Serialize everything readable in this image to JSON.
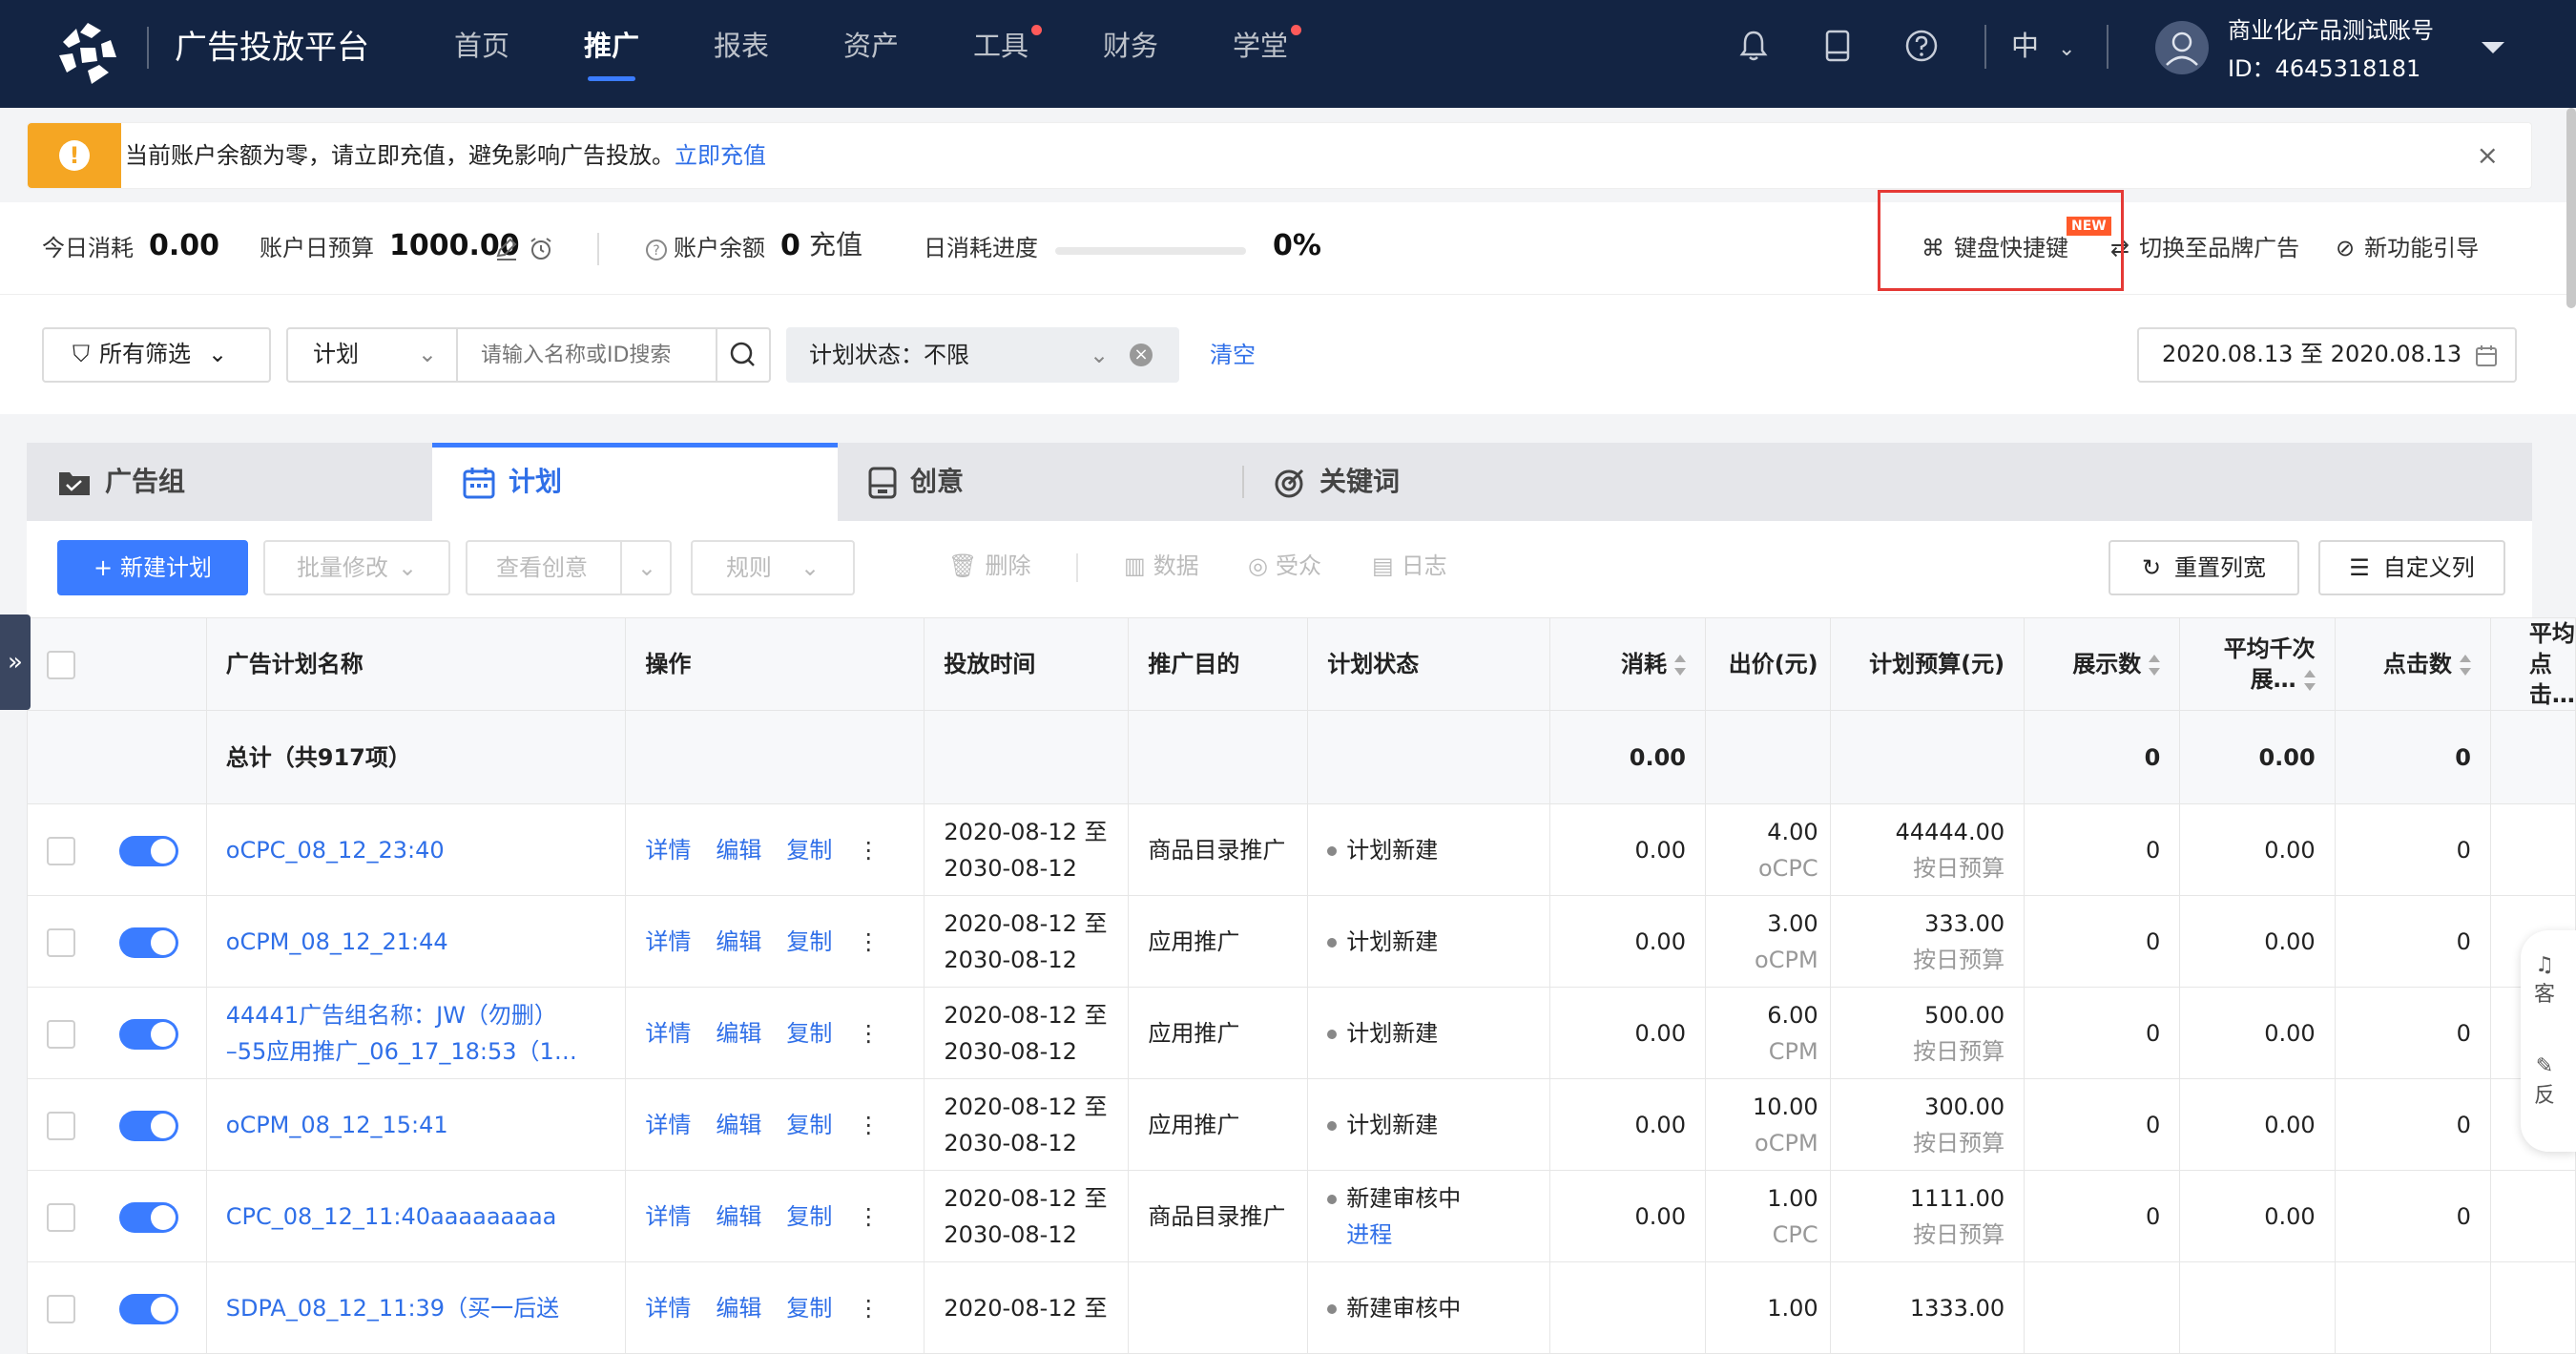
{
  "nav": {
    "brand": "广告投放平台",
    "items": [
      {
        "label": "首页",
        "active": false,
        "dot": false
      },
      {
        "label": "推广",
        "active": true,
        "dot": false
      },
      {
        "label": "报表",
        "active": false,
        "dot": false
      },
      {
        "label": "资产",
        "active": false,
        "dot": false
      },
      {
        "label": "工具",
        "active": false,
        "dot": true
      },
      {
        "label": "财务",
        "active": false,
        "dot": false
      },
      {
        "label": "学堂",
        "active": false,
        "dot": true
      }
    ],
    "language": "中",
    "account_name": "商业化产品测试账号",
    "account_id": "ID：4645318181"
  },
  "notice": {
    "message": "当前账户余额为零，请立即充值，避免影响广告投放。",
    "link": "立即充值"
  },
  "stats": {
    "today_spend_label": "今日消耗",
    "today_spend_value": "0.00",
    "daily_budget_label": "账户日预算",
    "daily_budget_value": "1000.00",
    "balance_label": "账户余额",
    "balance_value": "0",
    "recharge_label": "充值",
    "progress_label": "日消耗进度",
    "progress_value": "0%",
    "progress_fraction": 0,
    "shortcut_label": "键盘快捷键",
    "new_tag": "NEW",
    "switch_label": "切换至品牌广告",
    "guide_label": "新功能引导"
  },
  "filter": {
    "all_filters": "所有筛选",
    "scope": "计划",
    "search_placeholder": "请输入名称或ID搜索",
    "status_label": "计划状态：不限",
    "clear_label": "清空",
    "date_range": "2020.08.13 至 2020.08.13"
  },
  "tabs": [
    {
      "label": "广告组",
      "icon": "folder-icon"
    },
    {
      "label": "计划",
      "icon": "calendar-icon"
    },
    {
      "label": "创意",
      "icon": "creative-icon"
    },
    {
      "label": "关键词",
      "icon": "target-icon"
    }
  ],
  "toolbar": {
    "new_plan": "新建计划",
    "batch_edit": "批量修改",
    "view_creative": "查看创意",
    "rules": "规则",
    "delete": "删除",
    "data": "数据",
    "audience": "受众",
    "log": "日志",
    "reset_width": "重置列宽",
    "custom_columns": "自定义列"
  },
  "table": {
    "headers": [
      "广告计划名称",
      "操作",
      "投放时间",
      "推广目的",
      "计划状态",
      "消耗",
      "出价(元)",
      "计划预算(元)",
      "展示数",
      "平均千次展…",
      "点击数",
      "平均点击…"
    ],
    "total": {
      "label": "总计（共917项）",
      "spend": "0.00",
      "impressions": "0",
      "cpm": "0.00",
      "clicks": "0"
    },
    "ops": [
      "详情",
      "编辑",
      "复制"
    ],
    "rows": [
      {
        "name1": "oCPC_08_12_23:40",
        "name2": "",
        "time1": "2020-08-12 至",
        "time2": "2030-08-12",
        "purpose": "商品目录推广",
        "status": "计划新建",
        "status2": "",
        "spend": "0.00",
        "bid": "4.00",
        "bid_type": "oCPC",
        "budget": "44444.00",
        "budget_type": "按日预算",
        "impressions": "0",
        "cpm": "0.00",
        "clicks": "0"
      },
      {
        "name1": "oCPM_08_12_21:44",
        "name2": "",
        "time1": "2020-08-12 至",
        "time2": "2030-08-12",
        "purpose": "应用推广",
        "status": "计划新建",
        "status2": "",
        "spend": "0.00",
        "bid": "3.00",
        "bid_type": "oCPM",
        "budget": "333.00",
        "budget_type": "按日预算",
        "impressions": "0",
        "cpm": "0.00",
        "clicks": "0"
      },
      {
        "name1": "44441广告组名称：JW（勿删）",
        "name2": "–55应用推广_06_17_18:53（1…",
        "time1": "2020-08-12 至",
        "time2": "2030-08-12",
        "purpose": "应用推广",
        "status": "计划新建",
        "status2": "",
        "spend": "0.00",
        "bid": "6.00",
        "bid_type": "CPM",
        "budget": "500.00",
        "budget_type": "按日预算",
        "impressions": "0",
        "cpm": "0.00",
        "clicks": "0"
      },
      {
        "name1": "oCPM_08_12_15:41",
        "name2": "",
        "time1": "2020-08-12 至",
        "time2": "2030-08-12",
        "purpose": "应用推广",
        "status": "计划新建",
        "status2": "",
        "spend": "0.00",
        "bid": "10.00",
        "bid_type": "oCPM",
        "budget": "300.00",
        "budget_type": "按日预算",
        "impressions": "0",
        "cpm": "0.00",
        "clicks": "0"
      },
      {
        "name1": "CPC_08_12_11:40aaaaaaaaa",
        "name2": "",
        "time1": "2020-08-12 至",
        "time2": "2030-08-12",
        "purpose": "商品目录推广",
        "status": "新建审核中",
        "status2": "进程",
        "spend": "0.00",
        "bid": "1.00",
        "bid_type": "CPC",
        "budget": "1111.00",
        "budget_type": "按日预算",
        "impressions": "0",
        "cpm": "0.00",
        "clicks": "0"
      },
      {
        "name1": "SDPA_08_12_11:39（买一后送",
        "name2": "",
        "time1": "2020-08-12 至",
        "time2": "",
        "purpose": "",
        "status": "新建审核中",
        "status2": "",
        "spend": "",
        "bid": "1.00",
        "bid_type": "",
        "budget": "1333.00",
        "budget_type": "",
        "impressions": "",
        "cpm": "",
        "clicks": ""
      }
    ]
  },
  "float_panel": {
    "service": "客",
    "feedback": "反"
  }
}
